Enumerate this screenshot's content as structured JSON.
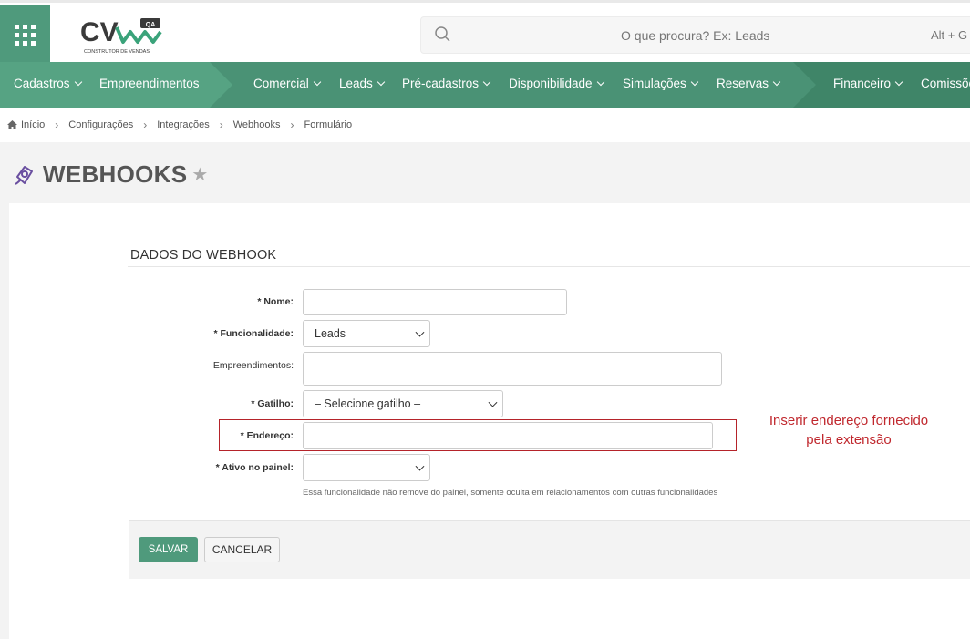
{
  "header": {
    "logo_text": "CV",
    "logo_badge": "QA",
    "logo_tagline": "CONSTRUTOR DE VENDAS",
    "search_placeholder": "O que procura? Ex: Leads",
    "search_shortcut": "Alt + G"
  },
  "nav": {
    "items": [
      {
        "label": "Cadastros",
        "dropdown": true
      },
      {
        "label": "Empreendimentos",
        "dropdown": false
      },
      {
        "label": "Comercial",
        "dropdown": true
      },
      {
        "label": "Leads",
        "dropdown": true
      },
      {
        "label": "Pré-cadastros",
        "dropdown": true
      },
      {
        "label": "Disponibilidade",
        "dropdown": true
      },
      {
        "label": "Simulações",
        "dropdown": true
      },
      {
        "label": "Reservas",
        "dropdown": true
      },
      {
        "label": "Financeiro",
        "dropdown": true
      },
      {
        "label": "Comissõe",
        "dropdown": false
      }
    ],
    "colors": {
      "bar": "#4a9275",
      "segment_light": "#56a383",
      "segment_dark": "#3f8568"
    }
  },
  "breadcrumb": [
    "Início",
    "Configurações",
    "Integrações",
    "Webhooks",
    "Formulário"
  ],
  "page": {
    "title": "WEBHOOKS",
    "star": "★"
  },
  "form": {
    "section_title": "DADOS DO WEBHOOK",
    "fields": {
      "nome": {
        "label": "* Nome:",
        "value": ""
      },
      "funcionalidade": {
        "label": "* Funcionalidade:",
        "value": "Leads"
      },
      "empreendimentos": {
        "label": "Empreendimentos:",
        "value": ""
      },
      "gatilho": {
        "label": "* Gatilho:",
        "value": "– Selecione gatilho –"
      },
      "endereco": {
        "label": "* Endereço:",
        "value": ""
      },
      "ativo": {
        "label": "* Ativo no painel:",
        "value": ""
      }
    },
    "help_text": "Essa funcionalidade não remove do painel, somente oculta em relacionamentos com outras funcionalidades",
    "annotation_line1": "Inserir endereço fornecido",
    "annotation_line2": "pela extensão",
    "save_label": "SALVAR",
    "cancel_label": "CANCELAR"
  },
  "colors": {
    "accent": "#4f9a7c",
    "annotation": "#c0282e"
  },
  "icons": {
    "apps": "apps-grid-icon",
    "search": "search-icon",
    "home": "home-icon",
    "title": "webhook-icon",
    "star": "star-icon"
  }
}
